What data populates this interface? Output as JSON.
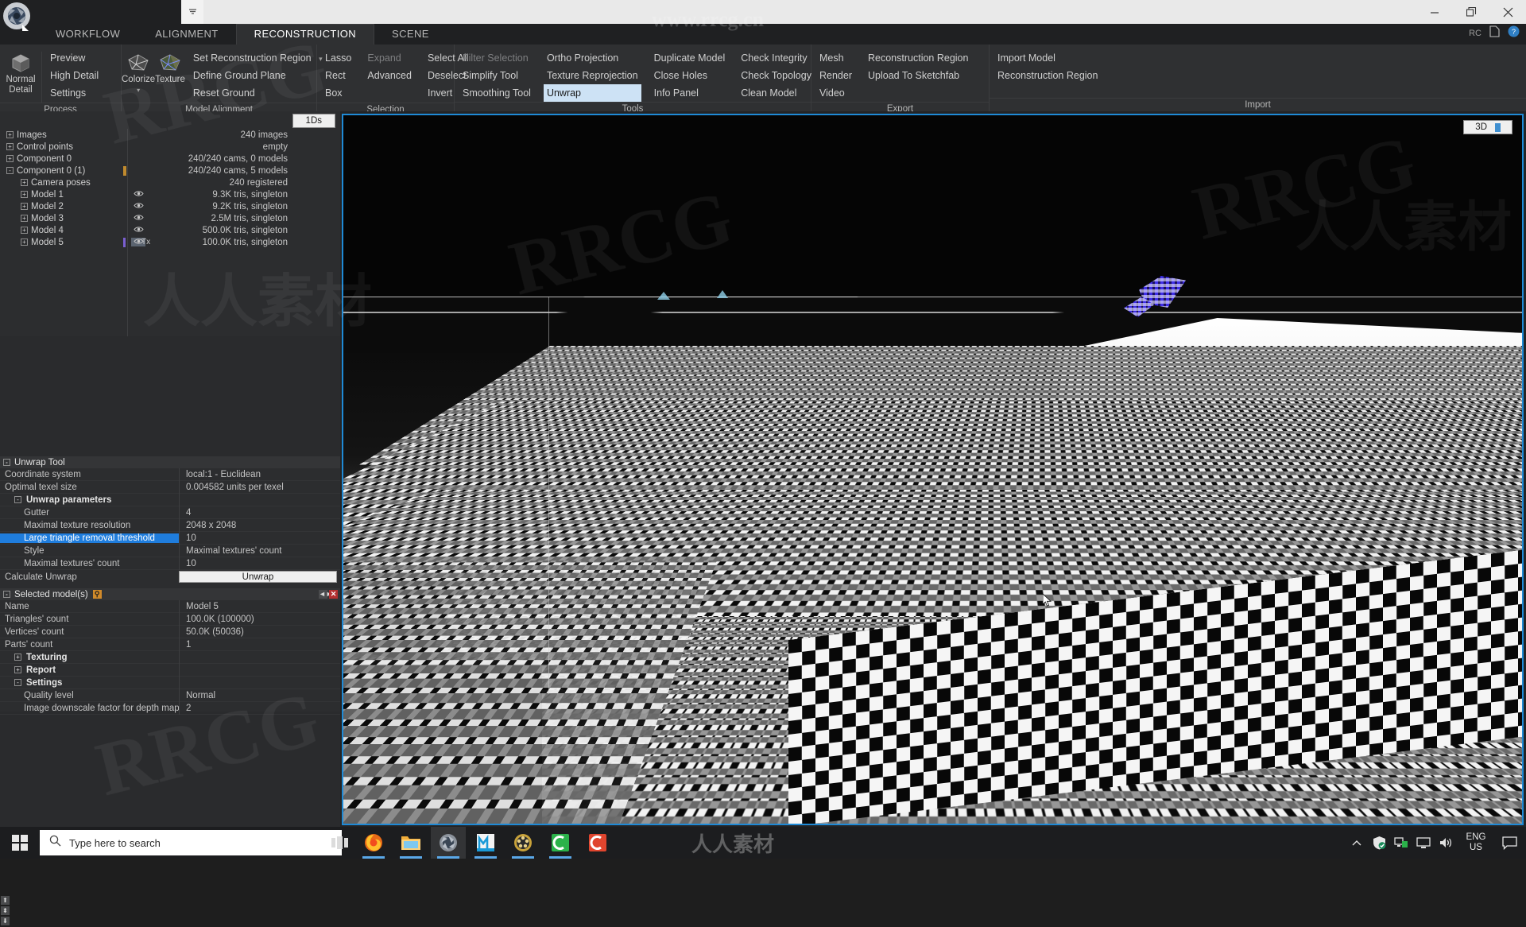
{
  "titlebar": {
    "qat_icons": [
      "layout-3panel-icon",
      "layout-2panel-icon",
      "layout-split-icon",
      "undo-icon",
      "redo-icon",
      "grid-view-icon",
      "list-view-icon",
      "tile-view-icon"
    ],
    "qat_dropdown": "chevron-down-icon",
    "minimize": "—",
    "maximize": "▭",
    "close": "✕",
    "right_icons": [
      "rc-label",
      "document-icon",
      "help-icon"
    ],
    "right_label": "RC"
  },
  "ribbon": {
    "tabs": [
      {
        "label": "WORKFLOW",
        "active": false
      },
      {
        "label": "ALIGNMENT",
        "active": false
      },
      {
        "label": "RECONSTRUCTION",
        "active": true
      },
      {
        "label": "SCENE",
        "active": false
      }
    ],
    "groups": [
      {
        "label": "Process",
        "big_buttons": [
          {
            "label_top": "Normal",
            "label_bottom": "Detail",
            "icon": "cube-icon"
          }
        ],
        "columns": [
          {
            "items": [
              {
                "label": "Preview",
                "state": "normal"
              },
              {
                "label": "High Detail",
                "state": "normal"
              },
              {
                "label": "Settings",
                "state": "normal"
              }
            ]
          }
        ]
      },
      {
        "label": "Model Alignment",
        "big_buttons": [
          {
            "label_top": "Colorize",
            "label_bottom": "",
            "icon": "colorize-mesh-icon",
            "caret": true
          },
          {
            "label_top": "Texture",
            "label_bottom": "",
            "icon": "texture-mesh-icon"
          }
        ],
        "columns": [
          {
            "items": [
              {
                "label": "Set Reconstruction Region",
                "state": "normal",
                "caret": true
              },
              {
                "label": "Define Ground Plane",
                "state": "normal"
              },
              {
                "label": "Reset Ground",
                "state": "normal"
              }
            ]
          }
        ]
      },
      {
        "label": "Selection",
        "big_buttons": [],
        "columns": [
          {
            "items": [
              {
                "label": "Lasso",
                "state": "normal"
              },
              {
                "label": "Rect",
                "state": "normal"
              },
              {
                "label": "Box",
                "state": "normal"
              }
            ]
          },
          {
            "items": [
              {
                "label": "Expand",
                "state": "dim"
              },
              {
                "label": "Advanced",
                "state": "normal"
              },
              {
                "label": "",
                "state": "normal"
              }
            ]
          },
          {
            "items": [
              {
                "label": "Select All",
                "state": "normal"
              },
              {
                "label": "Deselect",
                "state": "normal"
              },
              {
                "label": "Invert",
                "state": "normal"
              }
            ]
          }
        ]
      },
      {
        "label": "Tools",
        "big_buttons": [],
        "columns": [
          {
            "items": [
              {
                "label": "Filter Selection",
                "state": "dim"
              },
              {
                "label": "Simplify Tool",
                "state": "normal"
              },
              {
                "label": "Smoothing Tool",
                "state": "normal"
              }
            ]
          },
          {
            "items": [
              {
                "label": "Ortho Projection",
                "state": "normal"
              },
              {
                "label": "Texture Reprojection",
                "state": "normal"
              },
              {
                "label": "Unwrap",
                "state": "selected"
              }
            ]
          },
          {
            "items": [
              {
                "label": "Duplicate Model",
                "state": "normal"
              },
              {
                "label": "Close Holes",
                "state": "normal"
              },
              {
                "label": "Info Panel",
                "state": "normal"
              }
            ]
          },
          {
            "items": [
              {
                "label": "Check Integrity",
                "state": "normal"
              },
              {
                "label": "Check Topology",
                "state": "normal"
              },
              {
                "label": "Clean Model",
                "state": "normal"
              }
            ]
          }
        ]
      },
      {
        "label": "Export",
        "big_buttons": [],
        "columns": [
          {
            "items": [
              {
                "label": "Mesh",
                "state": "normal"
              },
              {
                "label": "Render",
                "state": "normal"
              },
              {
                "label": "Video",
                "state": "normal"
              }
            ]
          },
          {
            "items": [
              {
                "label": "Reconstruction Region",
                "state": "normal"
              },
              {
                "label": "Upload To Sketchfab",
                "state": "normal"
              },
              {
                "label": "",
                "state": "normal"
              }
            ]
          }
        ]
      },
      {
        "label": "Import",
        "big_buttons": [],
        "columns": [
          {
            "items": [
              {
                "label": "Import Model",
                "state": "normal"
              },
              {
                "label": "Reconstruction Region",
                "state": "normal"
              },
              {
                "label": "",
                "state": "normal"
              }
            ]
          }
        ]
      }
    ]
  },
  "tree": {
    "tab_label": "1Ds",
    "rows": [
      {
        "label": "Images",
        "value": "240 images",
        "indent": 0,
        "expander": "+",
        "eye": false,
        "tx": false
      },
      {
        "label": "Control points",
        "value": "empty",
        "indent": 0,
        "expander": "+",
        "eye": false,
        "tx": false
      },
      {
        "label": "Component 0",
        "value": "240/240 cams, 0 models",
        "indent": 0,
        "expander": "+",
        "eye": false,
        "tx": false
      },
      {
        "label": "Component 0 (1)",
        "value": "240/240 cams, 5 models",
        "indent": 0,
        "expander": "-",
        "eye": false,
        "tx": false
      },
      {
        "label": "Camera poses",
        "value": "240 registered",
        "indent": 1,
        "expander": "+",
        "eye": false,
        "tx": false
      },
      {
        "label": "Model 1",
        "value": "9.3K tris, singleton",
        "indent": 1,
        "expander": "+",
        "eye": true,
        "tx": false
      },
      {
        "label": "Model 2",
        "value": "9.2K tris, singleton",
        "indent": 1,
        "expander": "+",
        "eye": true,
        "tx": false
      },
      {
        "label": "Model 3",
        "value": "2.5M tris, singleton",
        "indent": 1,
        "expander": "+",
        "eye": true,
        "tx": false
      },
      {
        "label": "Model 4",
        "value": "500.0K tris, singleton",
        "indent": 1,
        "expander": "+",
        "eye": true,
        "tx": false
      },
      {
        "label": "Model 5",
        "value": "100.0K tris, singleton",
        "indent": 1,
        "expander": "+",
        "eye": true,
        "tx": true,
        "tx_label": "Tx"
      }
    ]
  },
  "unwrap_panel": {
    "title": "Unwrap Tool",
    "collapse_glyph": "-",
    "rows": [
      {
        "key": "Coordinate system",
        "value": "local:1 - Euclidean",
        "kind": "row"
      },
      {
        "key": "Optimal texel size",
        "value": "0.004582 units per texel",
        "kind": "row"
      },
      {
        "key": "Unwrap parameters",
        "value": "",
        "kind": "group",
        "glyph": "-"
      },
      {
        "key": "Gutter",
        "value": "4",
        "kind": "indent"
      },
      {
        "key": "Maximal texture resolution",
        "value": "2048 x 2048",
        "kind": "indent"
      },
      {
        "key": "Large triangle removal threshold",
        "value": "10",
        "kind": "indent",
        "selected": true
      },
      {
        "key": "Style",
        "value": "Maximal textures' count",
        "kind": "indent"
      },
      {
        "key": "Maximal textures' count",
        "value": "10",
        "kind": "indent"
      }
    ],
    "action_row": {
      "key": "Calculate Unwrap",
      "button": "Unwrap"
    },
    "spinners": [
      "⬆",
      "⬍",
      "⬇"
    ]
  },
  "selected_model_panel": {
    "title": "Selected model(s)",
    "collapse_glyph": "-",
    "pin_icon": "pin-icon",
    "controls": [
      {
        "name": "float-panel-button",
        "glyph": "◄►"
      },
      {
        "name": "close-panel-button",
        "glyph": "✕"
      }
    ],
    "rows": [
      {
        "key": "Name",
        "value": "Model 5",
        "kind": "row"
      },
      {
        "key": "Triangles' count",
        "value": "100.0K (100000)",
        "kind": "row"
      },
      {
        "key": "Vertices' count",
        "value": "50.0K (50036)",
        "kind": "row"
      },
      {
        "key": "Parts' count",
        "value": "1",
        "kind": "row"
      },
      {
        "key": "Texturing",
        "value": "",
        "kind": "group",
        "glyph": "+"
      },
      {
        "key": "Report",
        "value": "",
        "kind": "group",
        "glyph": "+"
      },
      {
        "key": "Settings",
        "value": "",
        "kind": "group",
        "glyph": "-"
      },
      {
        "key": "Quality level",
        "value": "Normal",
        "kind": "indent"
      },
      {
        "key": "Image downscale factor for depth maps",
        "value": "2",
        "kind": "indent"
      }
    ]
  },
  "viewport": {
    "tab_label": "3D",
    "accent_color": "#1f8ad6",
    "cursor_icon": "arrow-cursor-icon",
    "description": "Textured mesh preview with black-and-white UV checker pattern over terrain, blue-highlighted selected patch at upper right"
  },
  "taskbar": {
    "start_icon": "windows-start-icon",
    "search_placeholder": "Type here to search",
    "search_icon": "search-icon",
    "taskview_icon": "task-view-icon",
    "apps": [
      {
        "name": "firefox-icon",
        "active": false,
        "running": true
      },
      {
        "name": "file-explorer-icon",
        "active": false,
        "running": true
      },
      {
        "name": "reality-capture-icon",
        "active": true,
        "running": true
      },
      {
        "name": "metashape-icon",
        "active": false,
        "running": true
      },
      {
        "name": "media-player-icon",
        "active": false,
        "running": true
      },
      {
        "name": "cinema4d-icon",
        "active": false,
        "running": true
      },
      {
        "name": "capture-one-icon",
        "active": false,
        "running": false
      }
    ],
    "tray": {
      "chevron": "show-hidden-icons-icon",
      "icons": [
        "defender-shield-icon",
        "network-pc-icon",
        "monitor-icon",
        "volume-icon"
      ],
      "language_top": "ENG",
      "language_bottom": "US",
      "notifications": "action-center-icon"
    }
  },
  "watermarks": {
    "top": "www.rrcg.cn",
    "repeat": "RRCG",
    "cn": "人人素材",
    "bottom": "人人素材"
  }
}
